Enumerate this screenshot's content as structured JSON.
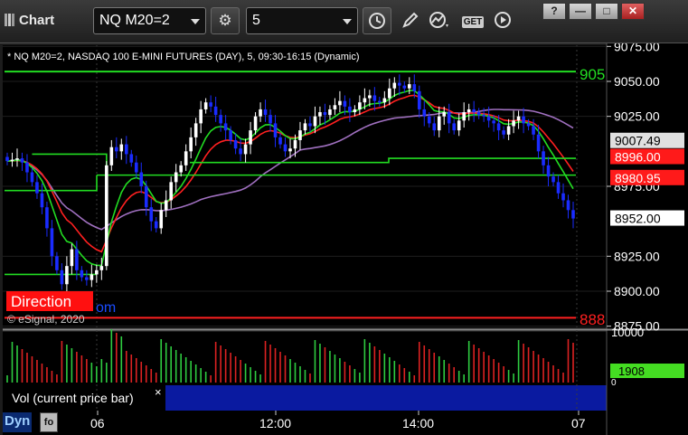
{
  "window": {
    "title": "Chart"
  },
  "toolbar": {
    "symbol_value": "NQ M20=2",
    "interval_value": "5",
    "get_label": "GET",
    "help_label": "?",
    "minimize_label": "—",
    "restore_label": "□",
    "close_label": "✕"
  },
  "chart": {
    "header": "* NQ M20=2, NASDAQ 100 E-MINI FUTURES (DAY), 5, 09:30-16:15 (Dynamic)",
    "copyright": "© eSignal, 2020",
    "direction_label": "Direction",
    "direction_suffix": "om",
    "top_level_label": "905",
    "bottom_level_label": "888",
    "vol_label": "Vol (current price bar)",
    "vol_close": "×",
    "dyn_label": "Dyn",
    "dyn_icon": "fo",
    "colors": {
      "up_candle": "#ffffff",
      "down_candle": "#1a2cff",
      "ma_fast": "#22dd22",
      "ma_red": "#ff2020",
      "ma_purple": "#a070c0",
      "level_green": "#22dd22",
      "level_red": "#ff2020",
      "vol_up": "#2ecc40",
      "vol_down": "#dd2222"
    }
  },
  "chart_data": {
    "type": "candlestick",
    "price_axis": {
      "ticks": [
        "9075.00",
        "9050.00",
        "9025.00",
        "8975.00",
        "8925.00",
        "8900.00",
        "8875.00"
      ],
      "ylim": [
        8875,
        9085
      ]
    },
    "time_axis": {
      "ticks": [
        "06",
        "12:00",
        "14:00",
        "07"
      ]
    },
    "price_labels": [
      {
        "text": "9007.49",
        "value": 9007.49,
        "bg": "#e0e0e0",
        "fg": "#000000"
      },
      {
        "text": "8996.00",
        "value": 8996.0,
        "bg": "#ff1a1a",
        "fg": "#ffffff"
      },
      {
        "text": "8980.95",
        "value": 8980.95,
        "bg": "#ff1a1a",
        "fg": "#ffffff"
      },
      {
        "text": "8952.00",
        "value": 8952.0,
        "bg": "#ffffff",
        "fg": "#000000"
      }
    ],
    "levels": {
      "upper": 9057,
      "lower": 8881
    },
    "volume_axis": {
      "top_label": "10000",
      "current_value": "1908",
      "bottom_label": "0"
    }
  }
}
